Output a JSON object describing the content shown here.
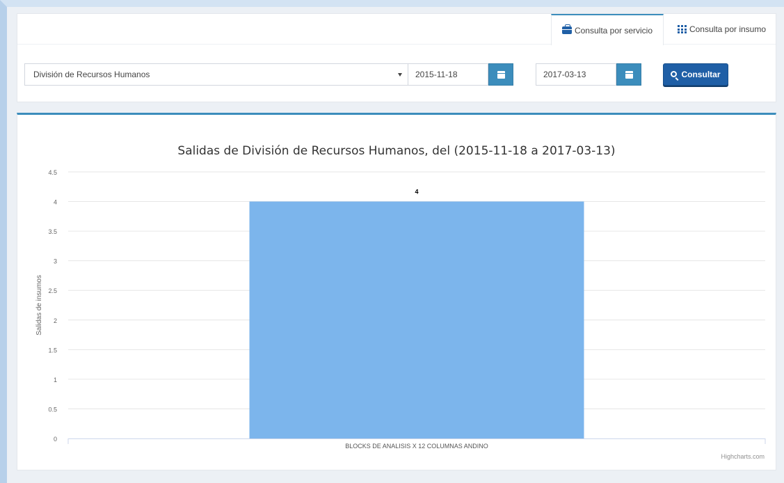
{
  "tabs": [
    {
      "label": "Consulta por servicio",
      "icon": "briefcase-icon",
      "active": true
    },
    {
      "label": "Consulta por insumo",
      "icon": "grid-icon",
      "active": false
    }
  ],
  "filters": {
    "service_select": "División de Recursos Humanos",
    "date_from": "2015-11-18",
    "date_to": "2017-03-13",
    "submit_label": "Consultar"
  },
  "colors": {
    "accent": "#3c8dbc",
    "primary_button": "#1f5fa6",
    "bar": "#7cb5ec"
  },
  "chart_data": {
    "type": "bar",
    "title": "Salidas de División de Recursos Humanos, del (2015-11-18 a 2017-03-13)",
    "xlabel": "",
    "ylabel": "Salidas de insumos",
    "categories": [
      "BLOCKS DE ANALISIS X 12 COLUMNAS ANDINO"
    ],
    "values": [
      4
    ],
    "data_labels": [
      "4"
    ],
    "ylim": [
      0,
      4.5
    ],
    "yticks": [
      "0",
      "0.5",
      "1",
      "1.5",
      "2",
      "2.5",
      "3",
      "3.5",
      "4",
      "4.5"
    ],
    "grid": true,
    "legend": "none",
    "credits": "Highcharts.com"
  }
}
